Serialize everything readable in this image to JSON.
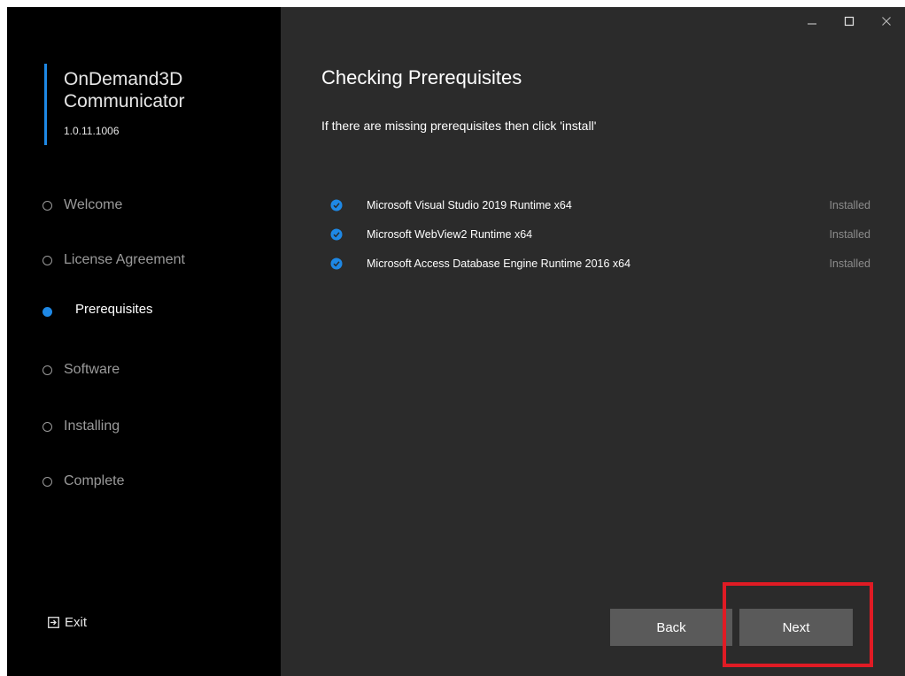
{
  "app": {
    "name": "OnDemand3D Communicator",
    "version": "1.0.11.1006"
  },
  "window_controls": {
    "minimize_icon": "minimize-icon",
    "maximize_icon": "maximize-icon",
    "close_icon": "close-icon"
  },
  "sidebar": {
    "steps": [
      {
        "label": "Welcome",
        "active": false
      },
      {
        "label": "License Agreement",
        "active": false
      },
      {
        "label": "Prerequisites",
        "active": true
      },
      {
        "label": "Software",
        "active": false
      },
      {
        "label": "Installing",
        "active": false
      },
      {
        "label": "Complete",
        "active": false
      }
    ],
    "exit_label": "Exit",
    "exit_icon": "exit-icon"
  },
  "main": {
    "title": "Checking Prerequisites",
    "subtitle": "If there are missing prerequisites then click 'install'",
    "prerequisites": [
      {
        "name": "Microsoft Visual Studio 2019 Runtime x64",
        "status": "Installed"
      },
      {
        "name": "Microsoft WebView2 Runtime x64",
        "status": "Installed"
      },
      {
        "name": "Microsoft Access Database Engine Runtime 2016 x64",
        "status": "Installed"
      }
    ]
  },
  "buttons": {
    "back_label": "Back",
    "next_label": "Next"
  },
  "colors": {
    "accent": "#1e88e5",
    "sidebar_bg": "#000000",
    "content_bg": "#2b2b2b",
    "button_bg": "#5a5a5a",
    "highlight": "#e01b24"
  }
}
